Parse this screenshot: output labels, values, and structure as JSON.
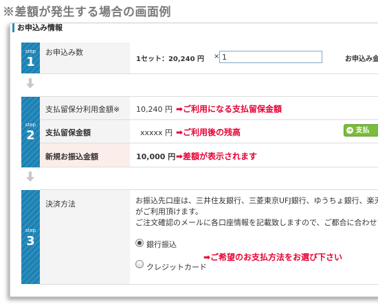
{
  "caption": "※差額が発生する場合の画面例",
  "section_title": "お申込み情報",
  "steps": [
    {
      "label": "step",
      "num": "1"
    },
    {
      "label": "step",
      "num": "2"
    },
    {
      "label": "step",
      "num": "3"
    }
  ],
  "row1": {
    "label": "お申込み数",
    "unit_price": "1セット：20,240 円",
    "times": "×",
    "quantity_value": "1",
    "total_label": "お申込み金"
  },
  "row2a": {
    "label": "支払留保分利用金額※",
    "value": "10,240 円",
    "note": "➡ご利用になる支払留保金額"
  },
  "row2b": {
    "label": "支払留保金額",
    "value": "xxxxx 円",
    "note": "➡ご利用後の残高",
    "button": "支払"
  },
  "row2c": {
    "label": "新規お振込金額",
    "value": "10,000 円",
    "note": "➡差額が表示されます"
  },
  "row3": {
    "label": "決済方法",
    "desc_line1": "お振込先口座は、三井住友銀行、三菱東京UFJ銀行、ゆうちょ銀行、楽天",
    "desc_line2": "がご利用頂けます。",
    "desc_line3": "ご注文確認のメールに各口座情報を記載致しますので、ご都合に合わせて",
    "option_bank": "銀行振込",
    "option_card": "クレジットカード",
    "note": "➡ご希望のお支払方法をお選び下さい"
  },
  "colors": {
    "step": "#1e7fae",
    "accent_red": "#e60033",
    "highlight": "#fbeeea",
    "button_green": "#7bbd3a"
  }
}
